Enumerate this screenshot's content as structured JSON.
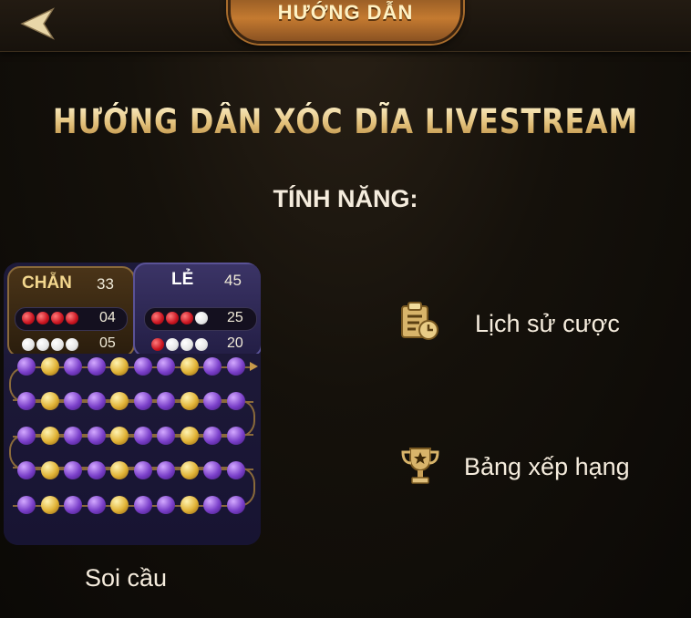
{
  "header": {
    "back_icon": "back-arrow-icon",
    "tab_label": "HƯỚNG DẪN"
  },
  "main": {
    "title": "HƯỚNG DẪN XÓC DĨA LIVESTREAM",
    "subtitle": "TÍNH NĂNG:"
  },
  "soi_cau": {
    "chan": {
      "label": "CHẴN",
      "count": "33",
      "rows": [
        {
          "dots": [
            "red",
            "red",
            "red",
            "red"
          ],
          "value": "04"
        },
        {
          "dots": [
            "white",
            "white",
            "white",
            "white"
          ],
          "value": "05"
        }
      ]
    },
    "le": {
      "label": "LẺ",
      "count": "45",
      "rows": [
        {
          "dots": [
            "red",
            "red",
            "red",
            "white"
          ],
          "value": "25"
        },
        {
          "dots": [
            "red",
            "white",
            "white",
            "white"
          ],
          "value": "20"
        }
      ]
    },
    "bead_rows": [
      [
        "p",
        "g",
        "p",
        "p",
        "g",
        "p",
        "p",
        "g",
        "p",
        "p"
      ],
      [
        "p",
        "g",
        "p",
        "p",
        "g",
        "p",
        "p",
        "g",
        "p",
        "p"
      ],
      [
        "p",
        "g",
        "p",
        "p",
        "g",
        "p",
        "p",
        "g",
        "p",
        "p"
      ],
      [
        "p",
        "g",
        "p",
        "p",
        "g",
        "p",
        "p",
        "g",
        "p",
        "p"
      ],
      [
        "p",
        "g",
        "p",
        "p",
        "g",
        "p",
        "p",
        "g",
        "p",
        "p"
      ]
    ],
    "caption": "Soi cầu"
  },
  "features": [
    {
      "icon": "clipboard-clock-icon",
      "label": "Lịch sử cược"
    },
    {
      "icon": "trophy-icon",
      "label": "Bảng xếp hạng"
    }
  ],
  "colors": {
    "gold": "#efd59a",
    "purple_bead": "#7a3fc9",
    "gold_bead": "#e0b236",
    "red_dot": "#c8121e"
  }
}
